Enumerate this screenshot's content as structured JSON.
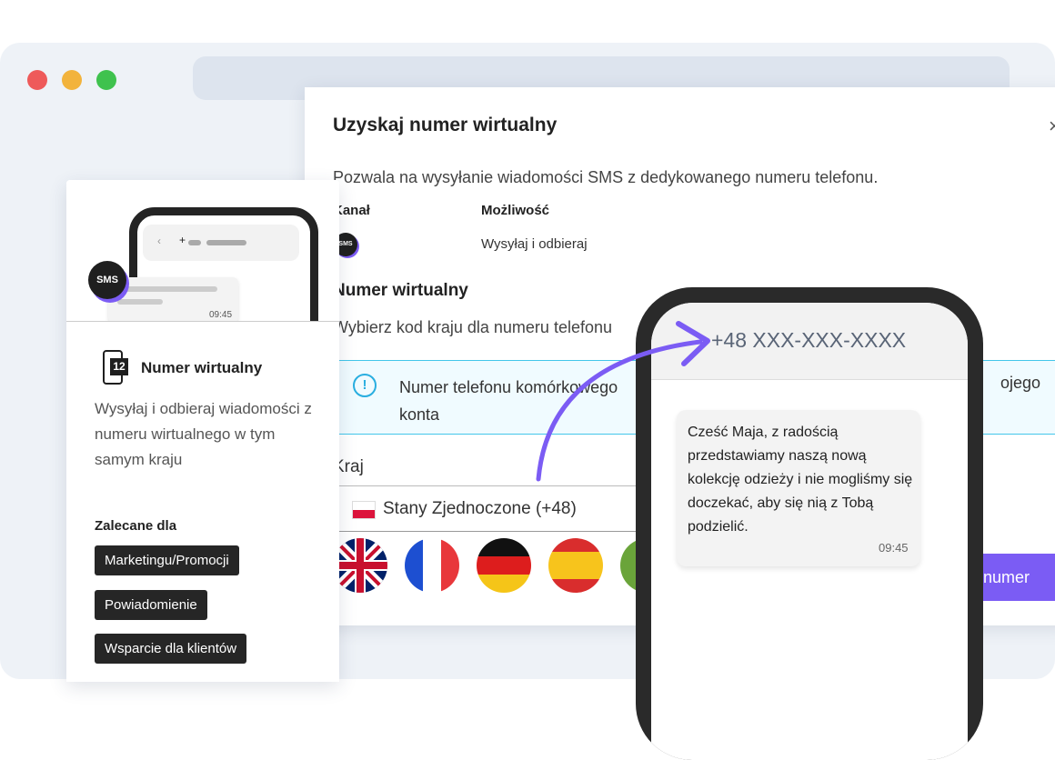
{
  "window": {
    "dots": [
      "#ee5a5a",
      "#f2b33c",
      "#3fc24e"
    ]
  },
  "dialog": {
    "title": "Uzyskaj numer wirtualny",
    "close_label": "×",
    "description": "Pozwala na wysyłanie wiadomości SMS z dedykowanego numeru telefonu.",
    "columns": {
      "channel": "Kanał",
      "capability": "Możliwość"
    },
    "channel_icon": "SMS",
    "capability_value": "Wysyłaj i odbieraj",
    "section_title": "Numer wirtualny",
    "section_subtitle": "Wybierz kod kraju dla numeru telefonu",
    "info_text": "Numer telefonu komórkowego",
    "info_text_line2": "konta",
    "info_tail": "ojego",
    "country_label": "Kraj",
    "country_value": "Stany Zjednoczone (+48)",
    "flags": [
      "uk-flag-icon",
      "france-flag-icon",
      "germany-flag-icon",
      "spain-flag-icon",
      "portugal-flag-icon"
    ],
    "get_button": "j numer",
    "accent_color": "#7b5cf4",
    "info_color": "#29aee0"
  },
  "card": {
    "badge": "SMS",
    "mini_time": "09:45",
    "icon_number": "12",
    "title": "Numer wirtualny",
    "description": "Wysyłaj i odbieraj wiadomości z numeru wirtualnego w tym samym kraju",
    "recommended_title": "Zalecane dla",
    "tags": [
      "Marketingu/Promocji",
      "Powiadomienie",
      "Wsparcie dla klientów"
    ]
  },
  "phone": {
    "number": "+48 XXX-XXX-XXXX",
    "message": "Cześć Maja, z radością przedstawiamy naszą nową kolekcję odzieży i nie mogliśmy się doczekać, aby się nią z Tobą podzielić.",
    "time": "09:45"
  }
}
